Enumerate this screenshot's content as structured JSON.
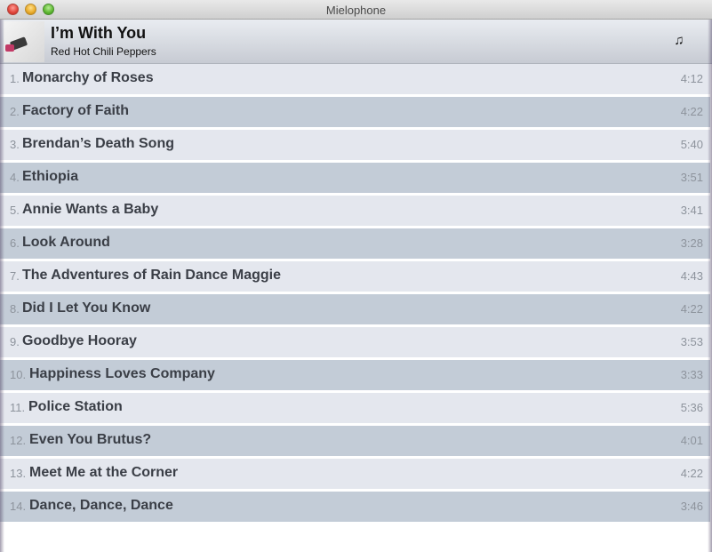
{
  "window": {
    "title": "Mielophone"
  },
  "header": {
    "album_title": "I’m With You",
    "artist": "Red Hot Chili Peppers",
    "note_icon": "music-note-icon",
    "note_glyph": "♫"
  },
  "tracks": [
    {
      "num": "1.",
      "name": "Monarchy of Roses",
      "duration": "4:12"
    },
    {
      "num": "2.",
      "name": "Factory of Faith",
      "duration": "4:22"
    },
    {
      "num": "3.",
      "name": "Brendan’s Death Song",
      "duration": "5:40"
    },
    {
      "num": "4.",
      "name": "Ethiopia",
      "duration": "3:51"
    },
    {
      "num": "5.",
      "name": "Annie Wants a Baby",
      "duration": "3:41"
    },
    {
      "num": "6.",
      "name": "Look Around",
      "duration": "3:28"
    },
    {
      "num": "7.",
      "name": "The Adventures of Rain Dance Maggie",
      "duration": "4:43"
    },
    {
      "num": "8.",
      "name": "Did I Let You Know",
      "duration": "4:22"
    },
    {
      "num": "9.",
      "name": "Goodbye Hooray",
      "duration": "3:53"
    },
    {
      "num": "10.",
      "name": "Happiness Loves Company",
      "duration": "3:33"
    },
    {
      "num": "11.",
      "name": "Police Station",
      "duration": "5:36"
    },
    {
      "num": "12.",
      "name": "Even You Brutus?",
      "duration": "4:01"
    },
    {
      "num": "13.",
      "name": "Meet Me at the Corner",
      "duration": "4:22"
    },
    {
      "num": "14.",
      "name": "Dance, Dance, Dance",
      "duration": "3:46"
    }
  ],
  "colors": {
    "row_light": "#e4e7ee",
    "row_dark": "#c3ccd7",
    "track_text": "#3a3e46",
    "muted_text": "#8d939c"
  }
}
